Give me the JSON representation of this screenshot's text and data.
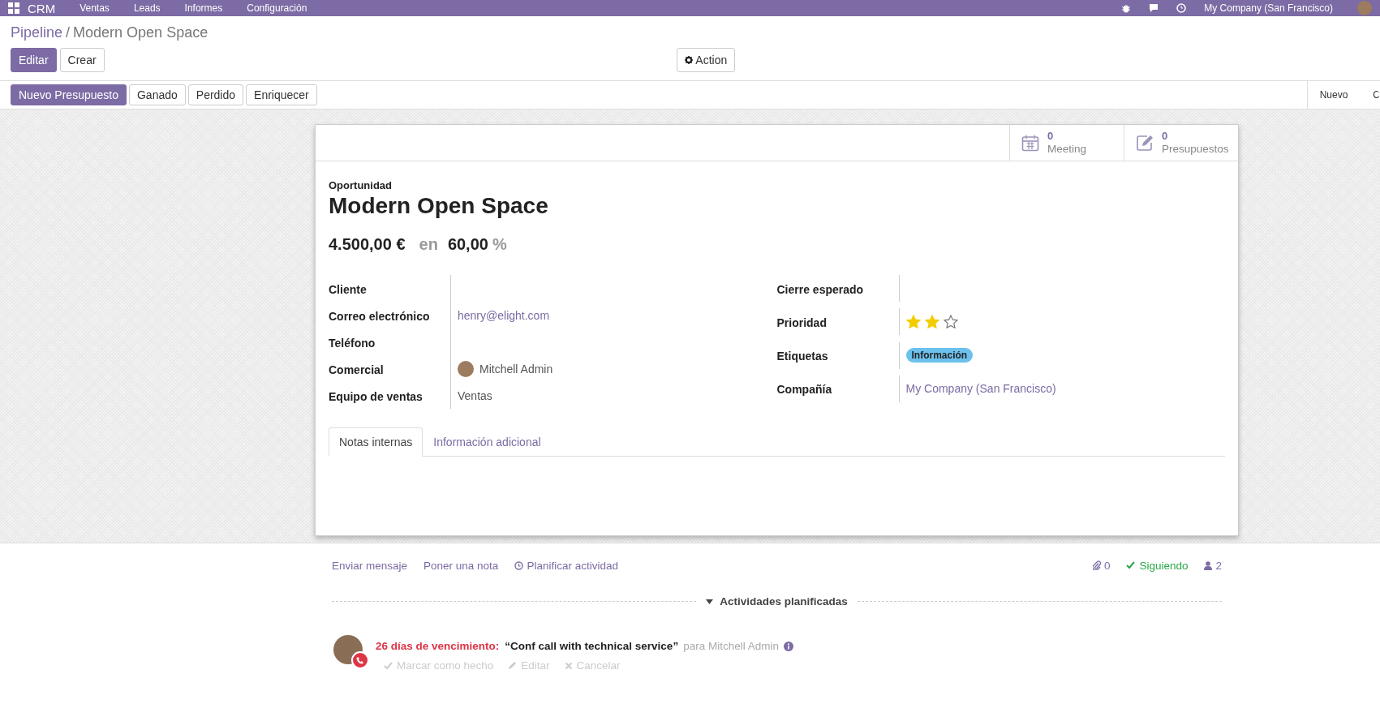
{
  "navbar": {
    "app": "CRM",
    "menus": [
      "Ventas",
      "Leads",
      "Informes",
      "Configuración"
    ],
    "company": "My Company (San Francisco)"
  },
  "breadcrumb_separator": "/",
  "breadcrumb": [
    {
      "label": "Pipeline",
      "kind": "link"
    },
    {
      "label": "Modern Open Space",
      "kind": "current"
    }
  ],
  "main_buttons": [
    {
      "label": "Editar",
      "primary": true
    },
    {
      "label": "Crear",
      "primary": false
    }
  ],
  "action_button": "Action",
  "header_buttons": [
    {
      "label": "Nuevo Presupuesto",
      "primary": true
    },
    {
      "label": "Ganado",
      "primary": false
    },
    {
      "label": "Perdido",
      "primary": false
    },
    {
      "label": "Enriquecer",
      "primary": false
    }
  ],
  "stages": [
    {
      "label": "Nuevo",
      "selected": false
    },
    {
      "label": "C",
      "selected": false
    }
  ],
  "stat_buttons": [
    {
      "kind": "calendar",
      "count": "0",
      "label": "Meeting"
    },
    {
      "kind": "edit",
      "count": "0",
      "label": "Presupuestos"
    }
  ],
  "record": {
    "type_label": "Oportunidad",
    "name": "Modern Open Space",
    "revenue": "4.500,00 €",
    "connector": "en",
    "probability": "60,00",
    "percent": "%"
  },
  "left_fields": [
    {
      "label": "Cliente",
      "kind": "empty"
    },
    {
      "label": "Correo electrónico",
      "kind": "link",
      "value": "henry@elight.com"
    },
    {
      "label": "Teléfono",
      "kind": "empty"
    },
    {
      "label": "Comercial",
      "kind": "user",
      "value": "Mitchell Admin"
    },
    {
      "label": "Equipo de ventas",
      "kind": "text",
      "value": "Ventas"
    }
  ],
  "right_fields": [
    {
      "label": "Cierre esperado",
      "kind": "empty"
    },
    {
      "label": "Prioridad",
      "kind": "stars",
      "stars": 2
    },
    {
      "label": "Etiquetas",
      "kind": "tags",
      "tags": [
        {
          "label": "Información",
          "color": "#6cc1ed"
        }
      ]
    },
    {
      "label": "Compañía",
      "kind": "link",
      "value": "My Company (San Francisco)"
    }
  ],
  "tabs": [
    {
      "label": "Notas internas",
      "selected": true
    },
    {
      "label": "Información adicional",
      "selected": false
    }
  ],
  "chatter": {
    "actions": [
      {
        "label": "Enviar mensaje",
        "kind": "plain"
      },
      {
        "label": "Poner una nota",
        "kind": "plain"
      },
      {
        "label": "Planificar actividad",
        "kind": "clock"
      }
    ],
    "attachments": "0",
    "following": "Siguiendo",
    "followers": "2",
    "section": "Actividades planificadas",
    "expanded": true,
    "activity": {
      "due": "26 días de vencimiento:",
      "summary": "“Conf call with technical service”",
      "assignee": "para Mitchell Admin",
      "actions": [
        {
          "label": "Marcar como hecho",
          "kind": "check"
        },
        {
          "label": "Editar",
          "kind": "pencil"
        },
        {
          "label": "Cancelar",
          "kind": "cross"
        }
      ]
    }
  }
}
